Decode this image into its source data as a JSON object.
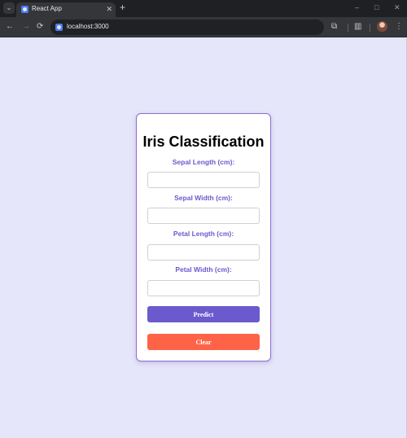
{
  "browser": {
    "tab_switcher_glyph": "⌄",
    "tab": {
      "title": "React App",
      "close_glyph": "✕"
    },
    "new_tab_glyph": "+",
    "window_controls": {
      "minimize": "–",
      "maximize": "□",
      "close": "✕"
    },
    "nav": {
      "back": "←",
      "forward": "→",
      "reload": "⟳"
    },
    "url": "localhost:3000",
    "icons": {
      "extensions": "extensions-icon",
      "side_panel": "side-panel-icon",
      "menu": "more-vert-icon"
    },
    "extensions_glyph": "⧉",
    "side_panel_glyph": "▥",
    "menu_glyph": "⋮"
  },
  "page": {
    "background_color": "#e6e6fa",
    "title": "Iris Classification",
    "fields": [
      {
        "label": "Sepal Length (cm):",
        "value": ""
      },
      {
        "label": "Sepal Width (cm):",
        "value": ""
      },
      {
        "label": "Petal Length (cm):",
        "value": ""
      },
      {
        "label": "Petal Width (cm):",
        "value": ""
      }
    ],
    "predict_button": "Predict",
    "clear_button": "Clear",
    "colors": {
      "accent": "#6a5acd",
      "clear": "#ff6347"
    }
  }
}
